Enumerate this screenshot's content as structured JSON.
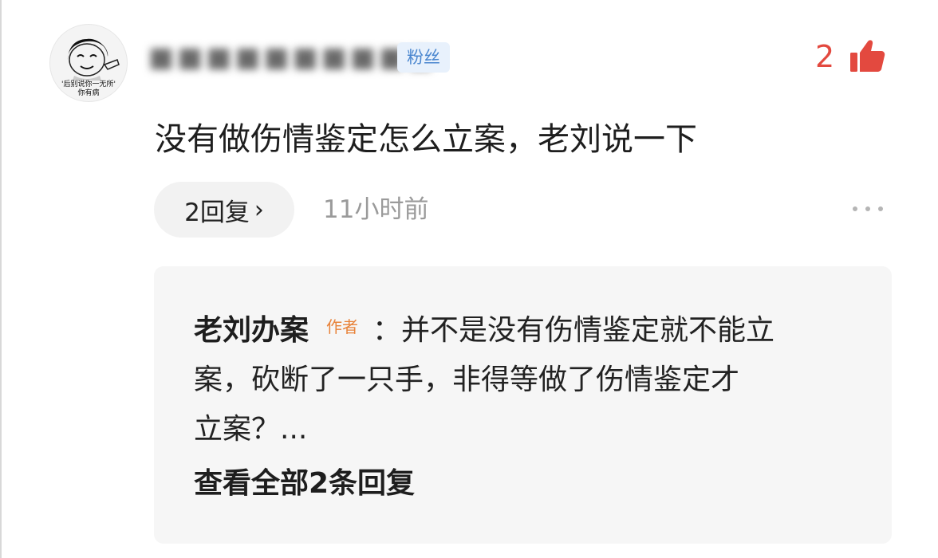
{
  "comment": {
    "avatar_caption_lines": [
      "'后别说你一无所'",
      "你有病"
    ],
    "username": "■■■■■■■■■■",
    "fan_badge": "粉丝",
    "like_count": "2",
    "text": "没有做伤情鉴定怎么立案，老刘说一下",
    "reply_button_label": "2回复",
    "reply_chevron": "›",
    "timestamp": "11小时前",
    "more_icon": "more-dots-icon",
    "like_icon": "thumbs-up-icon"
  },
  "reply": {
    "author": "老刘办案",
    "author_badge": "作者",
    "line1_text": "：并不是没有伤情鉴定就不能立",
    "line2_text": "案，砍断了一只手，非得等做了伤情鉴定才",
    "line3_text": "立案？...",
    "view_all_label": "查看全部2条回复"
  },
  "colors": {
    "like": "#e3493f",
    "fan_badge_text": "#4a86cf",
    "fan_badge_bg": "#e8f1fc",
    "author_badge": "#e8833a",
    "reply_box_bg": "#f6f6f6",
    "timestamp": "#9a9a9a"
  }
}
